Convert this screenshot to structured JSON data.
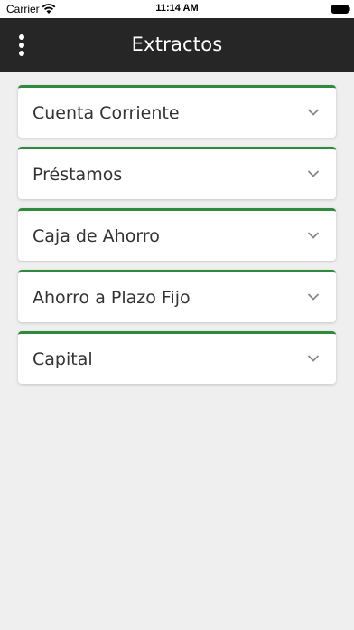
{
  "status_bar": {
    "carrier": "Carrier",
    "time": "11:14 AM"
  },
  "header": {
    "title": "Extractos",
    "menu_icon": "more-vertical-icon"
  },
  "accounts": [
    {
      "label": "Cuenta Corriente"
    },
    {
      "label": "Préstamos"
    },
    {
      "label": "Caja de Ahorro"
    },
    {
      "label": "Ahorro a Plazo Fijo"
    },
    {
      "label": "Capital"
    }
  ],
  "colors": {
    "header_bg": "#262626",
    "accent": "#2e8b3e",
    "background": "#efefef"
  }
}
